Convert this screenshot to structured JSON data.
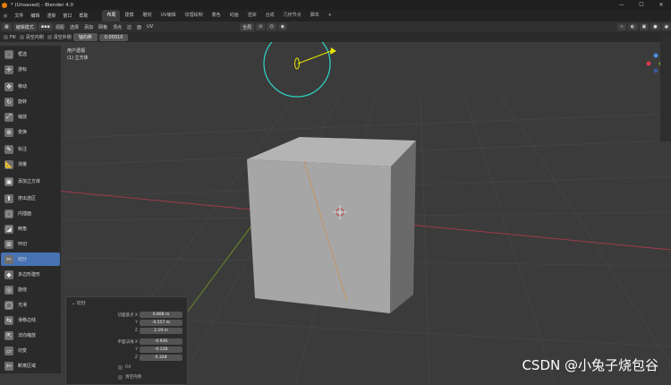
{
  "window": {
    "title": "* (Unsaved) - Blender 4.0",
    "min": "—",
    "max": "☐",
    "close": "✕"
  },
  "menus": [
    "文件",
    "编辑",
    "渲染",
    "窗口",
    "帮助"
  ],
  "workspaces": [
    "布局",
    "建模",
    "雕刻",
    "UV编辑",
    "纹理绘制",
    "着色",
    "动画",
    "渲染",
    "合成",
    "几何节点",
    "脚本",
    "+"
  ],
  "active_workspace": 0,
  "header": {
    "mode": "编辑模式",
    "view_menus": [
      "视图",
      "选择",
      "添加",
      "网格",
      "顶点",
      "边",
      "面",
      "UV"
    ],
    "transform_orientation": "全局"
  },
  "toolsettings": {
    "fill": "Fill",
    "clear_inner": "清空内侧",
    "clear_outer": "清空外侧",
    "snap_label": "轴向移",
    "snap_value": "0.00010"
  },
  "viewport": {
    "view_name": "用户透视",
    "object_name": "(1) 立方体"
  },
  "tools": [
    {
      "label": "框选",
      "icon": "⬚"
    },
    {
      "label": "游标",
      "icon": "✛"
    },
    {
      "label": "移动",
      "icon": "✥"
    },
    {
      "label": "旋转",
      "icon": "↻"
    },
    {
      "label": "缩放",
      "icon": "⤢"
    },
    {
      "label": "变换",
      "icon": "⊕"
    },
    {
      "label": "标注",
      "icon": "✎"
    },
    {
      "label": "测量",
      "icon": "📐"
    },
    {
      "label": "添加立方体",
      "icon": "▣"
    },
    {
      "label": "挤出选区",
      "icon": "⬆"
    },
    {
      "label": "内插面",
      "icon": "▢"
    },
    {
      "label": "倒角",
      "icon": "◪"
    },
    {
      "label": "环切",
      "icon": "⊞"
    },
    {
      "label": "切分",
      "icon": "✂"
    },
    {
      "label": "多边形建形",
      "icon": "◆"
    },
    {
      "label": "旋绕",
      "icon": "◎"
    },
    {
      "label": "光滑",
      "icon": "◯"
    },
    {
      "label": "滑移边线",
      "icon": "⇆"
    },
    {
      "label": "法向缩放",
      "icon": "⇱"
    },
    {
      "label": "切变",
      "icon": "▱"
    },
    {
      "label": "断离区域",
      "icon": "✄"
    }
  ],
  "active_tool": 13,
  "operator": {
    "title": "切分",
    "plane_point_label": "切面基点 X",
    "plane_point": {
      "x": "0.808 m",
      "y": "-0.557 m",
      "z": "2.19 m"
    },
    "plane_normal_label": "平面法线 X",
    "plane_normal": {
      "x": "-0.936",
      "y": "-0.128",
      "z": "0.328"
    },
    "y_label": "Y",
    "z_label": "Z",
    "fill": "Fill",
    "clear_inner": "清空内侧"
  },
  "watermark": "CSDN @小兔子烧包谷",
  "colors": {
    "active": "#4772b3",
    "cube_face": "#a6a6a6",
    "grid_x": "#a03a4a",
    "grid_y": "#6a8a2a",
    "light_ring": "#2dd6c6",
    "light_arrow": "#e8e400"
  }
}
